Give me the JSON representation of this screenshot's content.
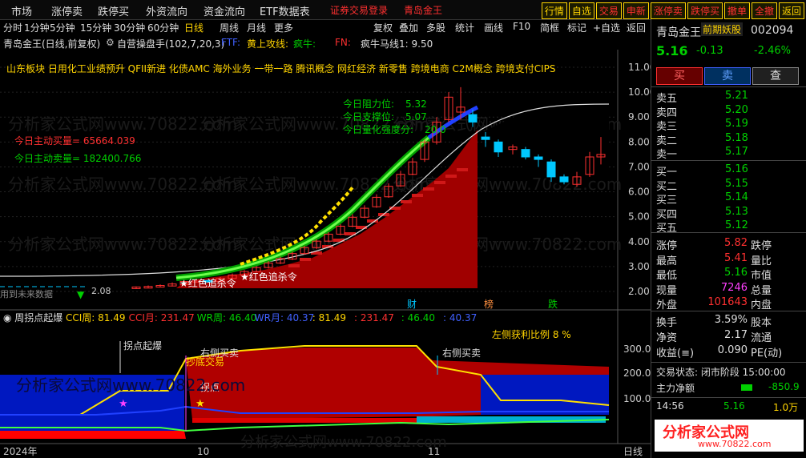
{
  "menu": [
    "市场",
    "涨停卖",
    "跌停买",
    "外资流向",
    "资金流向",
    "ETF数据表"
  ],
  "login": "证券交易登录",
  "login_stock": "青岛金王",
  "toolbar": [
    "行情",
    "自选",
    "交易",
    "申新",
    "涨停卖",
    "跌停买",
    "撤单",
    "全撤",
    "返回"
  ],
  "title": "青岛金王(日线,前复权)",
  "indicator_main": "自营操盘手(102,7,20,3)",
  "indicator_params": [
    "黄上攻线:",
    "疯牛:",
    "FN:",
    "疯牛马线1: 9.50"
  ],
  "periods": [
    "分时",
    "1分钟",
    "5分钟",
    "15分钟",
    "30分钟",
    "60分钟",
    "日线",
    "周线",
    "月线",
    "更多"
  ],
  "period_selected": "日线",
  "tools": [
    "复权",
    "叠加",
    "多股",
    "统计",
    "画线",
    "F10",
    "简框",
    "标记",
    "+自选",
    "返回"
  ],
  "sectors": "山东板块  日用化工业绩预升  QFII新进  化债AMC  海外业务  一带一路  腾讯概念  网红经济  新零售  跨境电商  C2M概念  跨境支付CIPS",
  "levels": {
    "resist_label": "今日阻力位:",
    "resist": "5.32",
    "support_label": "今日支撑位:",
    "support": "5.07",
    "strength_label": "今日量化强度分:",
    "strength": "20.0"
  },
  "active_buy": "今日主动买量= 65664.039",
  "active_sell": "今日主动卖量= 182400.766",
  "signals": [
    "红色追杀令",
    "红色追杀令"
  ],
  "future_label": "用到未来数据",
  "price_label": "2.08",
  "y_ticks": [
    "11.00",
    "10.00",
    "9.00",
    "8.00",
    "7.00",
    "6.00",
    "5.00",
    "4.00",
    "3.00",
    "2.00"
  ],
  "markers": [
    {
      "t": "财",
      "c": "#00c8ff"
    },
    {
      "t": "榜",
      "c": "#ff9040"
    },
    {
      "t": "跌",
      "c": "#00d000"
    }
  ],
  "sub_title": "周拐点起爆",
  "sub_params": [
    {
      "t": "CCI周: 81.49",
      "c": "#ffd400"
    },
    {
      "t": "CCI月: 231.47",
      "c": "#ff3030"
    },
    {
      "t": "WR周: 46.40",
      "c": "#00d000"
    },
    {
      "t": "WR月: 40.37",
      "c": "#4060ff"
    },
    {
      "t": ": 81.49",
      "c": "#ffd400"
    },
    {
      "t": ": 231.47",
      "c": "#ff3030"
    },
    {
      "t": ": 46.40",
      "c": "#00d000"
    },
    {
      "t": ": 40.37",
      "c": "#4060ff"
    }
  ],
  "left_profit": "左侧获利比例 8 %",
  "sub_labels": [
    "拐点起爆",
    "右侧买卖",
    "抄底交易",
    "拐点",
    "右侧买卖"
  ],
  "sub_y_ticks": [
    "300.0",
    "200.0",
    "100.0"
  ],
  "x_labels": [
    "2024年",
    "10",
    "11",
    "日线"
  ],
  "watermark": "分析家公式网www.70822.com",
  "stock": {
    "name": "青岛金王",
    "tag": "前期妖股",
    "code": "002094",
    "price": "5.16",
    "change": "-0.13",
    "pct": "-2.46%"
  },
  "buttons": [
    "买",
    "卖",
    "查"
  ],
  "asks": [
    {
      "l": "卖五",
      "v": "5.21"
    },
    {
      "l": "卖四",
      "v": "5.20"
    },
    {
      "l": "卖三",
      "v": "5.19"
    },
    {
      "l": "卖二",
      "v": "5.18"
    },
    {
      "l": "卖一",
      "v": "5.17"
    }
  ],
  "bids": [
    {
      "l": "买一",
      "v": "5.16"
    },
    {
      "l": "买二",
      "v": "5.15"
    },
    {
      "l": "买三",
      "v": "5.14"
    },
    {
      "l": "买四",
      "v": "5.13"
    },
    {
      "l": "买五",
      "v": "5.12"
    }
  ],
  "stats": [
    {
      "a": "涨停",
      "av": "5.82",
      "avc": "#ff3030",
      "b": "跌停",
      "bv": ""
    },
    {
      "a": "最高",
      "av": "5.41",
      "avc": "#ff3030",
      "b": "量比",
      "bv": ""
    },
    {
      "a": "最低",
      "av": "5.16",
      "avc": "#00d000",
      "b": "市值",
      "bv": ""
    },
    {
      "a": "现量",
      "av": "7246",
      "avc": "#ff40ff",
      "b": "总量",
      "bv": ""
    },
    {
      "a": "外盘",
      "av": "101643",
      "avc": "#ff3030",
      "b": "内盘",
      "bv": ""
    }
  ],
  "stats2": [
    {
      "a": "换手",
      "av": "3.59%",
      "avc": "#ddd",
      "b": "股本",
      "bv": ""
    },
    {
      "a": "净资",
      "av": "2.17",
      "avc": "#ddd",
      "b": "流通",
      "bv": ""
    },
    {
      "a": "收益(≡)",
      "av": "0.090",
      "avc": "#ddd",
      "b": "PE(动)",
      "bv": ""
    }
  ],
  "trade_status": "交易状态: 闭市阶段 15:00:00",
  "main_net": "主力净额",
  "main_net_val": "-850.9",
  "tick": {
    "time": "14:56",
    "price": "5.16",
    "vol": "1.0万"
  },
  "footer_logo": "分析家公式网",
  "footer_url": "www.70822.com",
  "colors": {
    "up": "#ff3030",
    "down": "#00c8ff",
    "accent": "#ffd400"
  }
}
